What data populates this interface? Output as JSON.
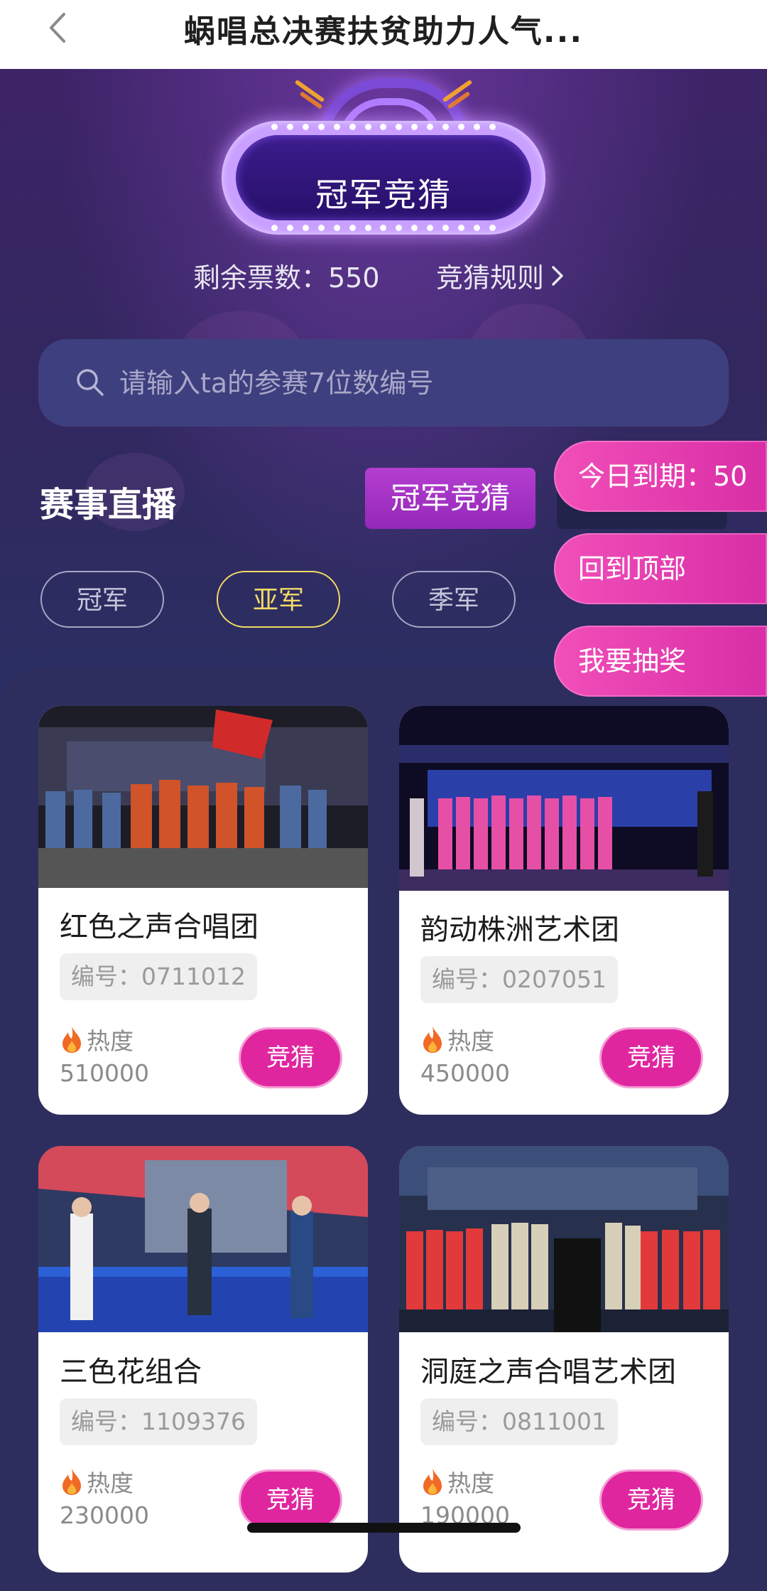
{
  "nav": {
    "title": "蜗唱总决赛扶贫助力人气..."
  },
  "hero": {
    "sign_label": "冠军竞猜",
    "tickets_label": "剩余票数：550",
    "rules_label": "竞猜规则"
  },
  "search": {
    "placeholder": "请输入ta的参赛7位数编号"
  },
  "section": {
    "title": "赛事直播",
    "active_tab": "冠军竞猜",
    "hidden_tab": "冠军竞猜"
  },
  "filters": [
    "冠军",
    "亚军",
    "季军"
  ],
  "selected_filter": "亚军",
  "floating": {
    "expiry": "今日到期：50",
    "back_top": "回到顶部",
    "lottery": "我要抽奖"
  },
  "cards": [
    {
      "name": "红色之声合唱团",
      "code": "编号：0711012",
      "heat_label": "热度",
      "heat": "510000",
      "button": "竞猜"
    },
    {
      "name": "韵动株洲艺术团",
      "code": "编号：0207051",
      "heat_label": "热度",
      "heat": "450000",
      "button": "竞猜"
    },
    {
      "name": "三色花组合",
      "code": "编号：1109376",
      "heat_label": "热度",
      "heat": "230000",
      "button": "竞猜"
    },
    {
      "name": "洞庭之声合唱艺术团",
      "code": "编号：0811001",
      "heat_label": "热度",
      "heat": "190000",
      "button": "竞猜"
    }
  ],
  "colors": {
    "accent_pink": "#e0269f",
    "tab_purple": "#a634c4",
    "selected_gold": "#f2da66"
  }
}
